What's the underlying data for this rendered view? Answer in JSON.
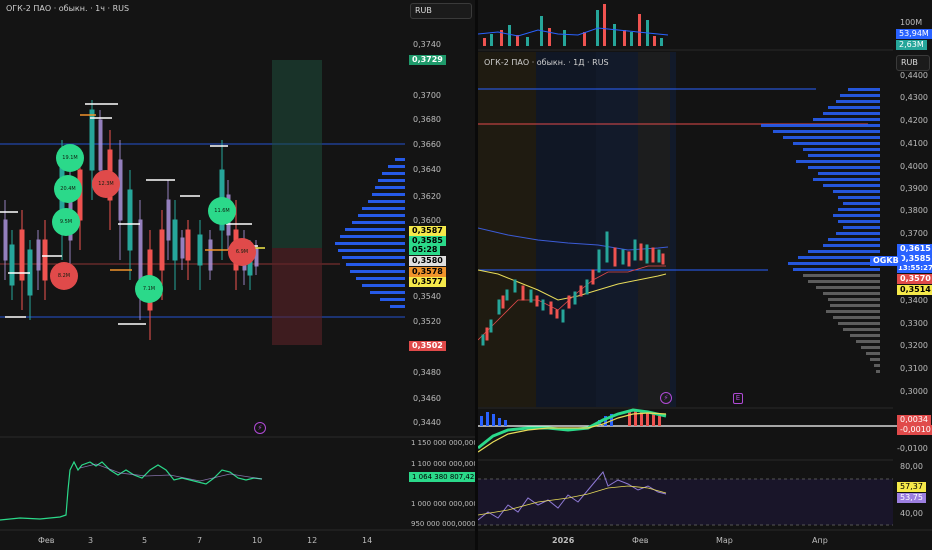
{
  "colors": {
    "up": "#26a69a",
    "down": "#ef5350",
    "bg": "#131313",
    "grid": "#1e1e1e",
    "blue": "#2962ff",
    "green": "#2bd98a",
    "red": "#e04a4a",
    "yellow": "#f5e94a",
    "orange": "#f0932b",
    "purple": "#b04ad6"
  },
  "left": {
    "title": "ОГК-2 ПАО · обыкн. · 1ч · RUS",
    "currency": "RUB",
    "price_ticks": [
      "0,3740",
      "0,3720",
      "0,3700",
      "0,3680",
      "0,3660",
      "0,3640",
      "0,3620",
      "0,3600",
      "0,3580",
      "0,3560",
      "0,3540",
      "0,3520",
      "0,3500",
      "0,3480",
      "0,3460",
      "0,3440"
    ],
    "tags": [
      {
        "text": "0,3729",
        "color": "#1f9a6b"
      },
      {
        "text": "0,3587",
        "color": "#f5e94a"
      },
      {
        "text": "0,3585",
        "color": "#2bd98a"
      },
      {
        "text": "05:28",
        "color": "#2bd98a"
      },
      {
        "text": "0,3580",
        "color": "#e0e0e0"
      },
      {
        "text": "0,3578",
        "color": "#f0932b"
      },
      {
        "text": "0,3577",
        "color": "#f5e94a"
      },
      {
        "text": "0,3502",
        "color": "#e04a4a"
      }
    ],
    "circles": [
      {
        "text": "19.1M",
        "color": "#2bd98a"
      },
      {
        "text": "20.4M",
        "color": "#2bd98a"
      },
      {
        "text": "9.5M",
        "color": "#2bd98a"
      },
      {
        "text": "12.3M",
        "color": "#e04a4a"
      },
      {
        "text": "8.2M",
        "color": "#e04a4a"
      },
      {
        "text": "7.1M",
        "color": "#2bd98a"
      },
      {
        "text": "11.6M",
        "color": "#2bd98a"
      },
      {
        "text": "6.9M",
        "color": "#e04a4a"
      }
    ],
    "indicator_ticks": [
      "1 150 000 000,0000",
      "1 100 000 000,0000",
      "1 050 000 000,0000",
      "1 000 000 000,0000",
      "950 000 000,0000"
    ],
    "indicator_tag": "1 064 380 807,4251",
    "time_ticks": [
      "Фев",
      "3",
      "5",
      "7",
      "10",
      "12",
      "14"
    ]
  },
  "right": {
    "title": "ОГК-2 ПАО · обыкн. · 1Д · RUS",
    "currency": "RUB",
    "volume_ticks": [
      "100M"
    ],
    "volume_tags": [
      {
        "text": "53,94M",
        "color": "#2962ff"
      },
      {
        "text": "2,63M",
        "color": "#26a69a"
      }
    ],
    "price_ticks": [
      "0,4400",
      "0,4300",
      "0,4200",
      "0,4100",
      "0,4000",
      "0,3900",
      "0,3800",
      "0,3700",
      "0,3600",
      "0,3500",
      "0,3400",
      "0,3300",
      "0,3200",
      "0,3100",
      "0,3000"
    ],
    "symbol": "OGKB",
    "tags": [
      {
        "text": "0,3615",
        "color": "#2962ff"
      },
      {
        "text": "0,3585",
        "color": "#2962ff"
      },
      {
        "text": "13:55:27",
        "color": "#2962ff"
      },
      {
        "text": "0,3570",
        "color": "#e04a4a"
      },
      {
        "text": "0,3514",
        "color": "#f5e94a"
      }
    ],
    "macd_tags": [
      {
        "text": "0,0034",
        "color": "#e04a4a"
      },
      {
        "text": "-0,0010",
        "color": "#e04a4a"
      }
    ],
    "macd_ticks": [
      "-0,0100"
    ],
    "rsi_ticks": [
      "80,00",
      "40,00"
    ],
    "rsi_tags": [
      {
        "text": "57,37",
        "color": "#f5e94a"
      },
      {
        "text": "53,75",
        "color": "#9c7fe0"
      }
    ],
    "time_ticks": [
      "2026",
      "Фев",
      "Мар",
      "Апр"
    ]
  }
}
